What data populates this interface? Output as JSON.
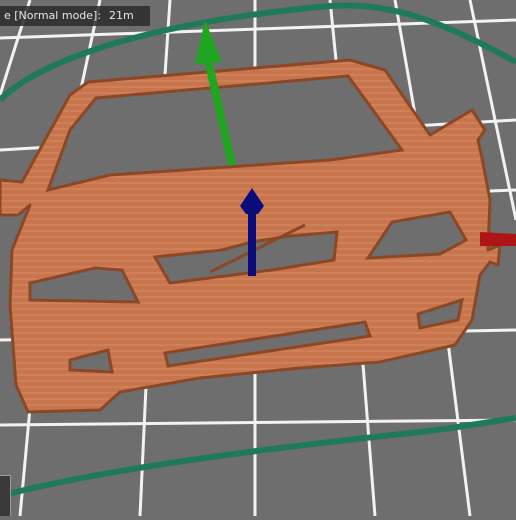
{
  "status": {
    "mode_text": "e [Normal mode]:",
    "time_text": "21m"
  },
  "colors": {
    "bed": "#6e6e6e",
    "grid_line": "#f2f2f2",
    "skirt": "#1f7a5a",
    "print": "#c8754e",
    "print_edge": "#8a4826",
    "gizmo_x": "#b01515",
    "gizmo_y": "#1fa51f",
    "gizmo_z": "#0b0b7a"
  },
  "icons": {
    "axis_gizmo": "move-gizmo-icon"
  }
}
